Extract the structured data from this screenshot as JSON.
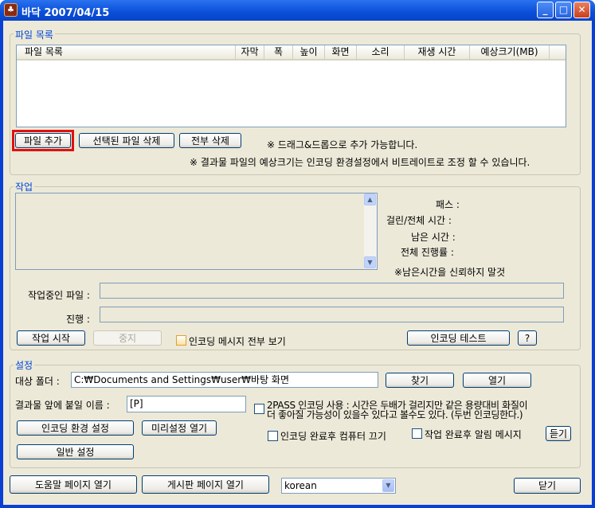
{
  "window": {
    "title": "바닥 2007/04/15",
    "app_icon": "app-icon",
    "minimize": "_",
    "maximize": "□",
    "close": "✕"
  },
  "files": {
    "group_label": "파일 목록",
    "columns": [
      "파일 목록",
      "자막",
      "폭",
      "높이",
      "화면",
      "소리",
      "재생 시간",
      "예상크기(MB)"
    ],
    "add_button": "파일 추가",
    "delete_selected_button": "선택된 파일 삭제",
    "delete_all_button": "전부 삭제",
    "hint_drag": "※ 드래그&드롭으로 추가 가능합니다.",
    "hint_size": "※ 결과물 파일의 예상크기는 인코딩 환경설정에서 비트레이트로 조정 할 수 있습니다."
  },
  "job": {
    "group_label": "작업",
    "pass_label": "패스 :",
    "elapsed_label": "걸린/전체 시간 :",
    "remaining_label": "남은 시간 :",
    "total_progress_label": "전체 진행률 :",
    "remaining_note": "※남은시간을 신뢰하지 말것",
    "current_file_label": "작업중인 파일 :",
    "current_file_value": "",
    "progress_label": "진행 :",
    "progress": 0,
    "start_button": "작업 시작",
    "stop_button": "중지",
    "show_messages_label": "인코딩 메시지 전부 보기",
    "encoding_test_button": "인코딩 테스트",
    "help_button": "?"
  },
  "settings": {
    "group_label": "설정",
    "target_folder_label": "대상 폴더 :",
    "target_folder_value": "C:₩Documents and Settings₩user₩바탕 화면",
    "find_button": "찾기",
    "open_button": "열기",
    "prefix_label": "결과물 앞에 붙일 이름 :",
    "prefix_value": "[P]",
    "twopass_line1": "2PASS 인코딩 사용 : 시간은 두배가 걸리지만 같은 용량대비 화질이",
    "twopass_line2": "더 좋아질 가능성이 있을수 있다고 볼수도 있다. (두번 인코딩한다.)",
    "encoding_env_button": "인코딩 환경 설정",
    "preset_open_button": "미리설정 열기",
    "shutdown_label": "인코딩 완료후 컴퓨터 끄기",
    "notify_label": "작업 완료후 알림 메시지",
    "listen_button": "듣기",
    "general_settings_button": "일반 설정"
  },
  "footer": {
    "help_page_button": "도움말 페이지 열기",
    "board_page_button": "게시판 페이지 열기",
    "language_selected": "korean",
    "close_button": "닫기"
  }
}
